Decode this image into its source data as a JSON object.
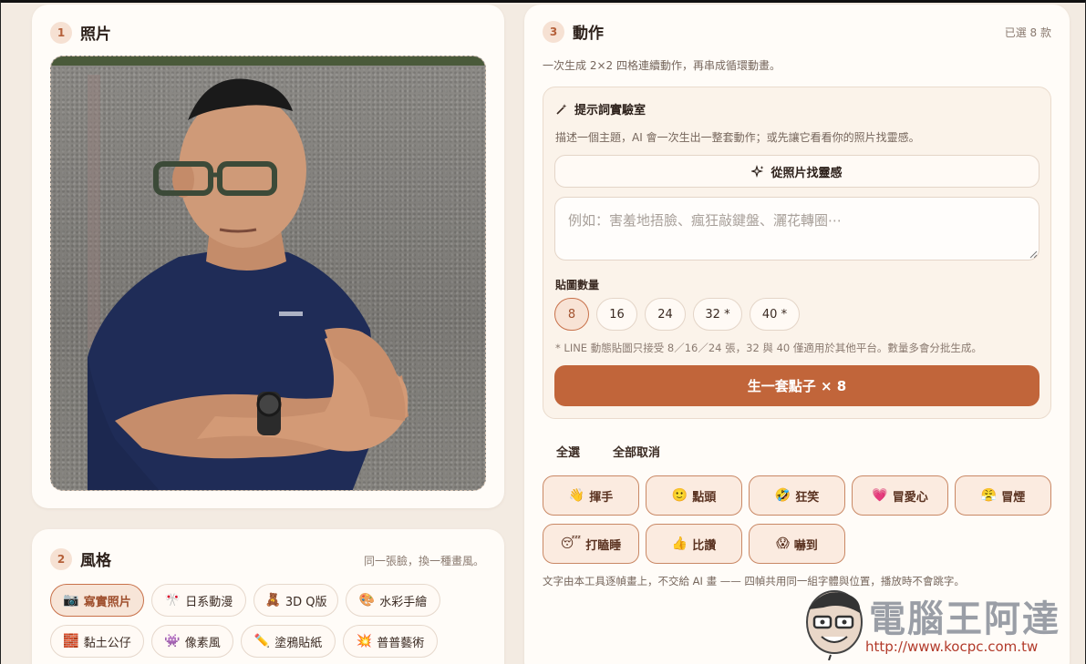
{
  "photo_section": {
    "step": "1",
    "title": "照片"
  },
  "style_section": {
    "step": "2",
    "title": "風格",
    "note": "同一張臉，換一種畫風。",
    "chips": [
      {
        "emoji": "📷",
        "label": "寫實照片",
        "selected": true
      },
      {
        "emoji": "🎌",
        "label": "日系動漫",
        "selected": false
      },
      {
        "emoji": "🧸",
        "label": "3D Q版",
        "selected": false
      },
      {
        "emoji": "🎨",
        "label": "水彩手繪",
        "selected": false
      },
      {
        "emoji": "🧱",
        "label": "黏土公仔",
        "selected": false
      },
      {
        "emoji": "👾",
        "label": "像素風",
        "selected": false
      },
      {
        "emoji": "✏️",
        "label": "塗鴉貼紙",
        "selected": false
      },
      {
        "emoji": "💥",
        "label": "普普藝術",
        "selected": false
      }
    ]
  },
  "action_section": {
    "step": "3",
    "title": "動作",
    "selected_count": "已選 8 款",
    "subtitle": "一次生成 2×2 四格連續動作，再串成循環動畫。",
    "lab": {
      "title": "提示詞實驗室",
      "description": "描述一個主題，AI 會一次生出一整套動作；或先讓它看看你的照片找靈感。",
      "inspire_label": "從照片找靈感",
      "input_placeholder": "例如：害羞地捂臉、瘋狂敲鍵盤、灑花轉圈⋯",
      "input_value": "",
      "count_label": "貼圖數量",
      "count_options": [
        {
          "label": "8",
          "selected": true
        },
        {
          "label": "16",
          "selected": false
        },
        {
          "label": "24",
          "selected": false
        },
        {
          "label": "32 *",
          "selected": false
        },
        {
          "label": "40 *",
          "selected": false
        }
      ],
      "count_note": "* LINE 動態貼圖只接受 8／16／24 張，32 與 40 僅適用於其他平台。數量多會分批生成。",
      "generate_label": "生一套點子 × 8"
    },
    "select_all": "全選",
    "deselect_all": "全部取消",
    "actions": [
      {
        "emoji": "👋",
        "label": "揮手"
      },
      {
        "emoji": "🙂",
        "label": "點頭"
      },
      {
        "emoji": "🤣",
        "label": "狂笑"
      },
      {
        "emoji": "💗",
        "label": "冒愛心"
      },
      {
        "emoji": "😤",
        "label": "冒煙"
      },
      {
        "emoji": "😴",
        "label": "打瞌睡"
      },
      {
        "emoji": "👍",
        "label": "比讚"
      },
      {
        "emoji": "😱",
        "label": "嚇到"
      }
    ],
    "footnote": "文字由本工具逐幀畫上，不交給 AI 畫 —— 四幀共用同一組字體與位置，播放時不會跳字。"
  },
  "watermark": {
    "title": "電腦王阿達",
    "url": "http://www.kocpc.com.tw"
  },
  "colors": {
    "accent": "#c1653a",
    "background": "#f3ebe2",
    "card": "#fffcf8"
  }
}
